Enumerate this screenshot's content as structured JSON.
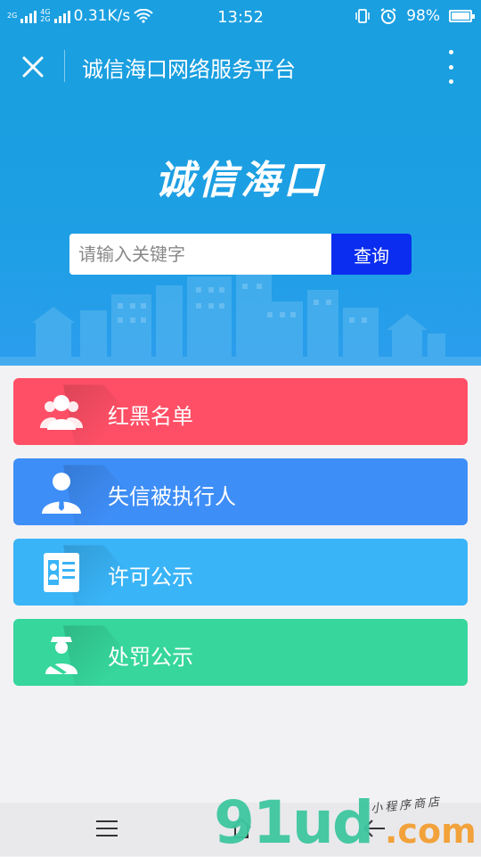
{
  "status_bar": {
    "network_1": "2G",
    "network_2a": "4G",
    "network_2b": "2G",
    "speed": "0.31K/s",
    "time": "13:52",
    "battery": "98%",
    "battery_level": 0.98
  },
  "navbar": {
    "title": "诚信海口网络服务平台"
  },
  "hero": {
    "logo_text": "诚信海口",
    "search_placeholder": "请输入关键字",
    "search_button": "查询"
  },
  "menu": {
    "items": [
      {
        "label": "红黑名单",
        "color": "#ff4f66",
        "icon": "people-group-icon"
      },
      {
        "label": "失信被执行人",
        "color": "#3e8ef7",
        "icon": "person-suit-icon"
      },
      {
        "label": "许可公示",
        "color": "#39b4f7",
        "icon": "id-card-icon"
      },
      {
        "label": "处罚公示",
        "color": "#36d69c",
        "icon": "officer-icon"
      }
    ]
  },
  "watermark": {
    "main": "91ud",
    "suffix": ".com",
    "small": "小程序商店"
  }
}
